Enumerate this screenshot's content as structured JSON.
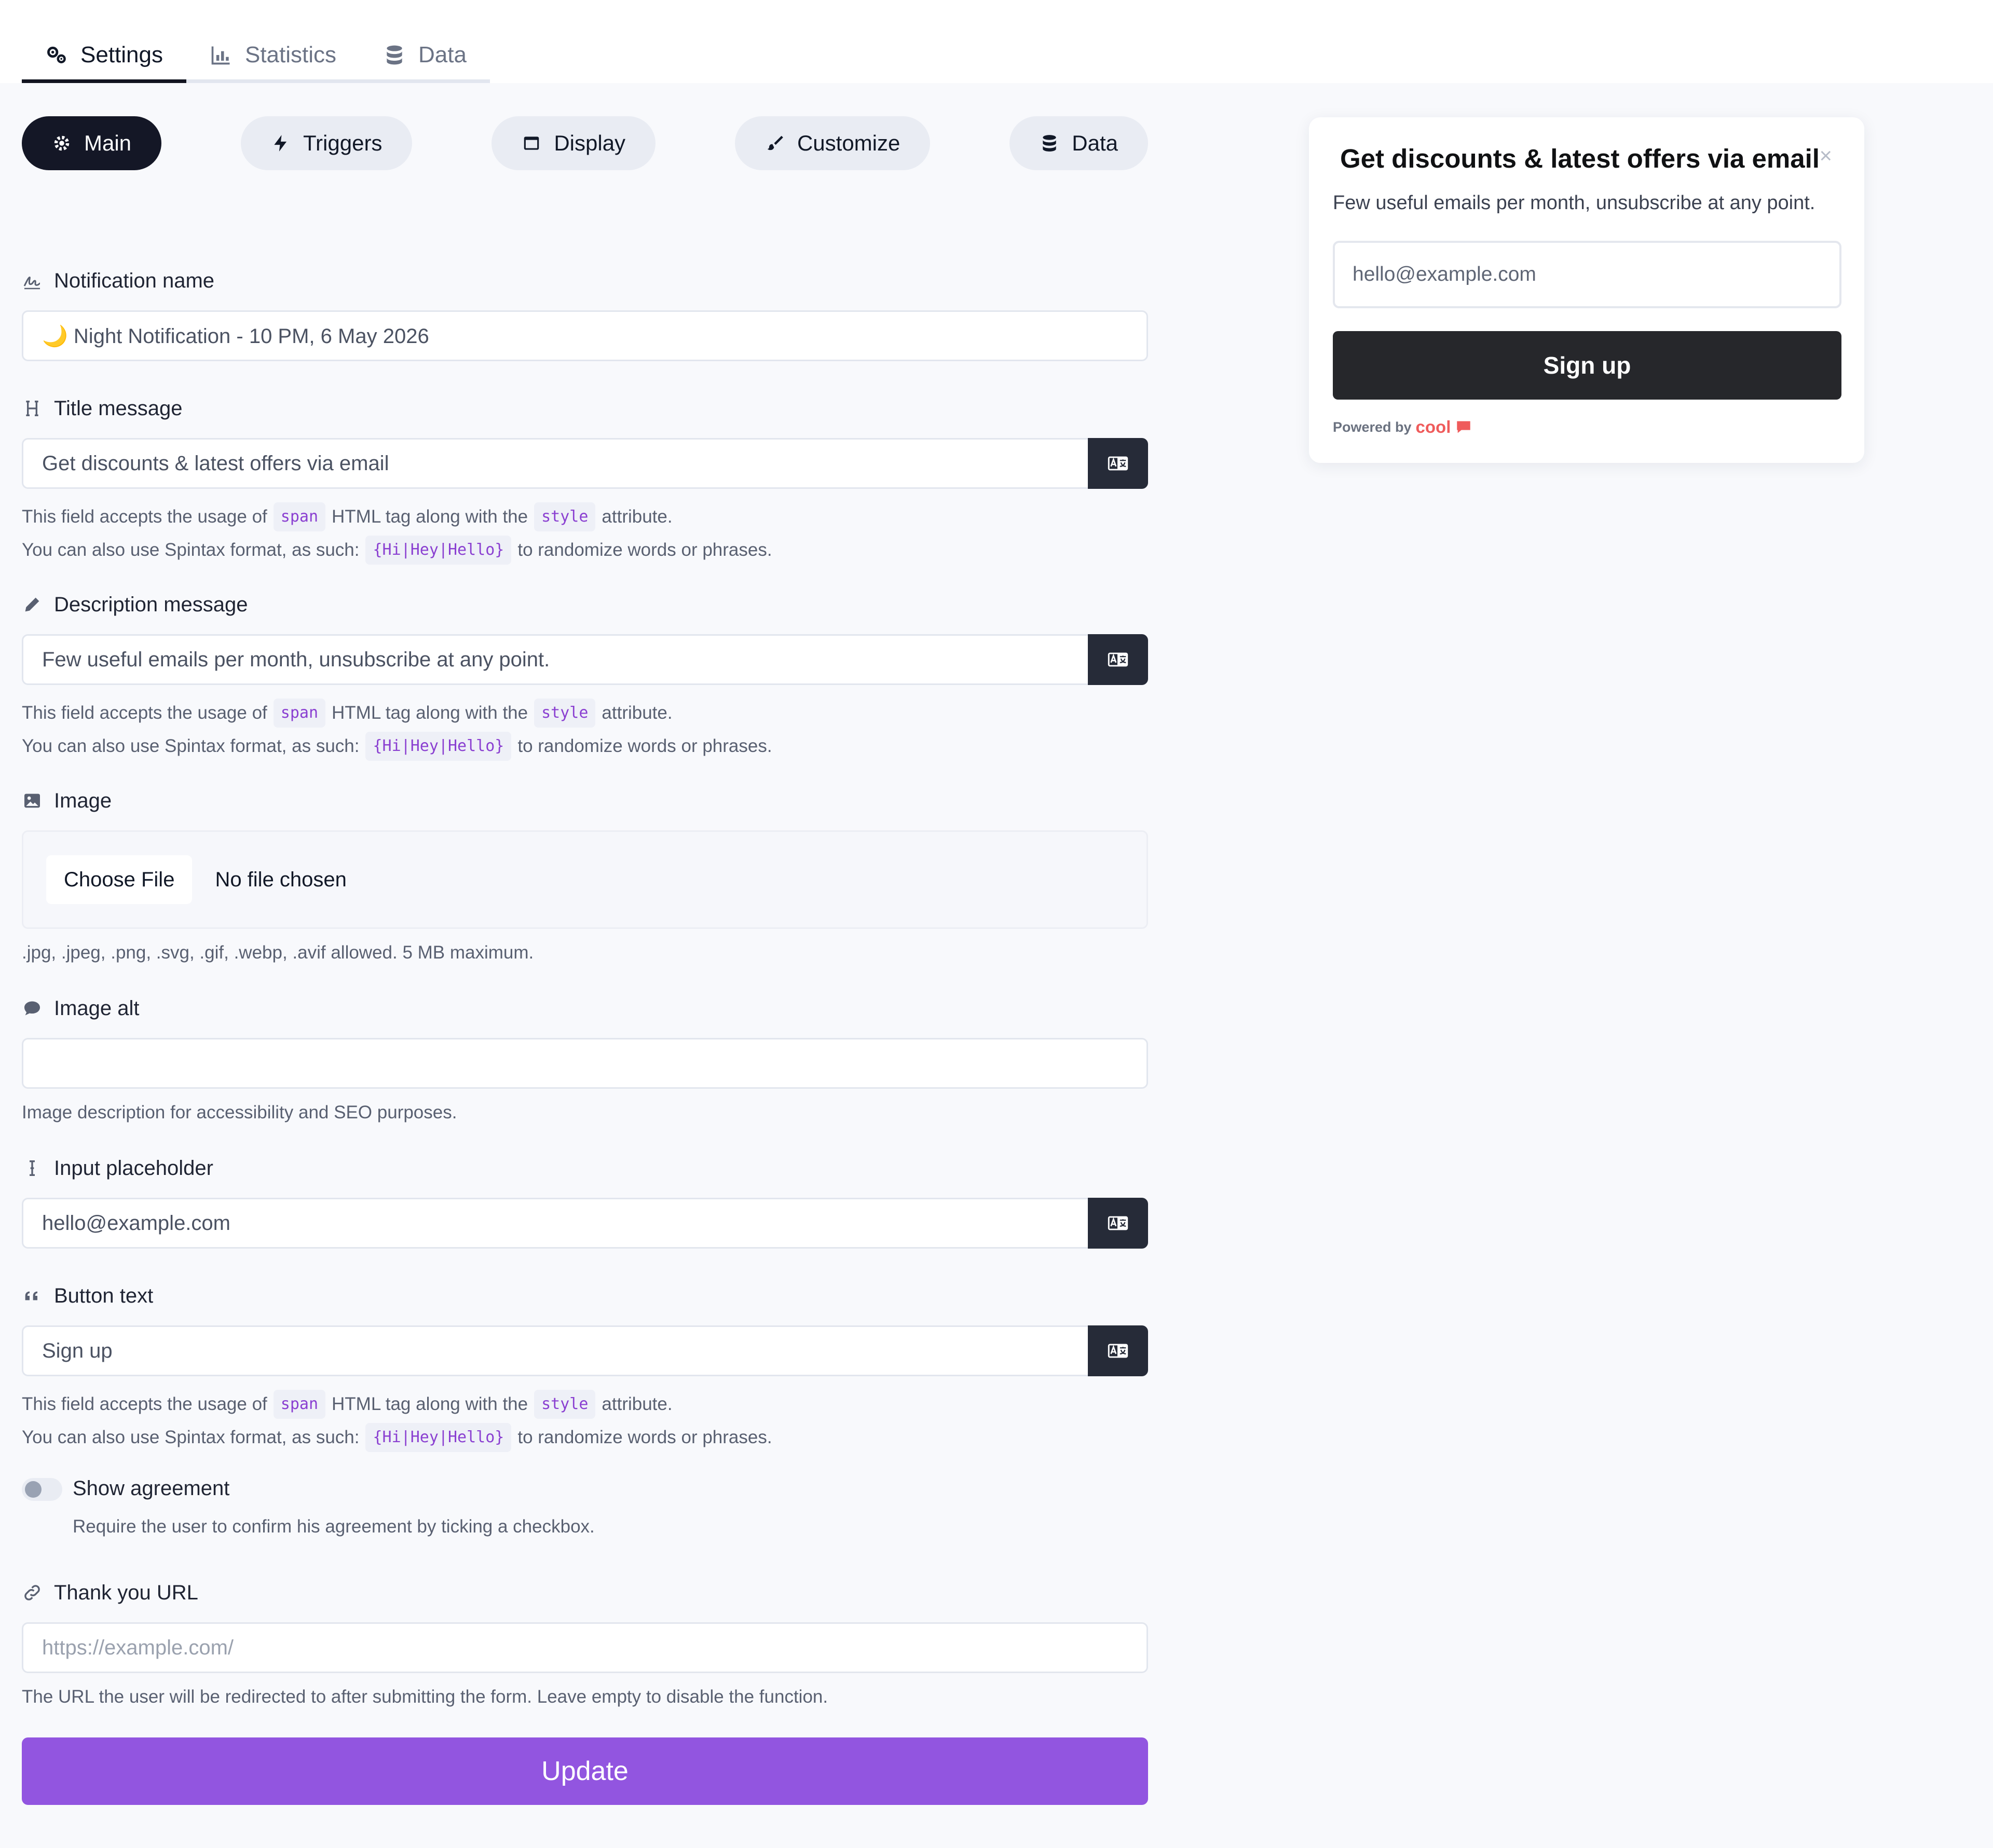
{
  "top_tabs": [
    {
      "label": "Settings",
      "icon": "gears-icon",
      "active": true
    },
    {
      "label": "Statistics",
      "icon": "chart-icon",
      "active": false
    },
    {
      "label": "Data",
      "icon": "database-icon",
      "active": false
    }
  ],
  "sub_tabs": [
    {
      "label": "Main",
      "icon": "gear-icon",
      "active": true
    },
    {
      "label": "Triggers",
      "icon": "bolt-icon",
      "active": false
    },
    {
      "label": "Display",
      "icon": "window-icon",
      "active": false
    },
    {
      "label": "Customize",
      "icon": "brush-icon",
      "active": false
    },
    {
      "label": "Data",
      "icon": "database-icon",
      "active": false
    }
  ],
  "fields": {
    "notification_name": {
      "label": "Notification name",
      "value": "🌙 Night Notification - 10 PM, 6 May 2026"
    },
    "title_message": {
      "label": "Title message",
      "value": "Get discounts & latest offers via email"
    },
    "description_message": {
      "label": "Description message",
      "value": "Few useful emails per month, unsubscribe at any point."
    },
    "image": {
      "label": "Image",
      "button": "Choose File",
      "status": "No file chosen",
      "help": ".jpg, .jpeg, .png, .svg, .gif, .webp, .avif allowed. 5 MB maximum."
    },
    "image_alt": {
      "label": "Image alt",
      "value": "",
      "help": "Image description for accessibility and SEO purposes."
    },
    "input_placeholder": {
      "label": "Input placeholder",
      "value": "hello@example.com"
    },
    "button_text": {
      "label": "Button text",
      "value": "Sign up"
    },
    "show_agreement": {
      "label": "Show agreement",
      "help": "Require the user to confirm his agreement by ticking a checkbox.",
      "enabled": false
    },
    "thank_you_url": {
      "label": "Thank you URL",
      "placeholder": "https://example.com/",
      "help": "The URL the user will be redirected to after submitting the form. Leave empty to disable the function."
    }
  },
  "help_text": {
    "accepts_1": "This field accepts the usage of",
    "span_tag": "span",
    "accepts_2": "HTML tag along with the",
    "style_attr": "style",
    "accepts_3": "attribute.",
    "spintax_1": "You can also use Spintax format, as such:",
    "spintax_example": "{Hi|Hey|Hello}",
    "spintax_2": "to randomize words or phrases."
  },
  "update_label": "Update",
  "preview": {
    "title": "Get discounts & latest offers via email",
    "close": "×",
    "description": "Few useful emails per month, unsubscribe at any point.",
    "input_placeholder": "hello@example.com",
    "button": "Sign up",
    "powered_by": "Powered by",
    "brand": "cool"
  },
  "colors": {
    "accent": "#9255e0",
    "dark": "#141726",
    "brand": "#ef5b5b"
  }
}
